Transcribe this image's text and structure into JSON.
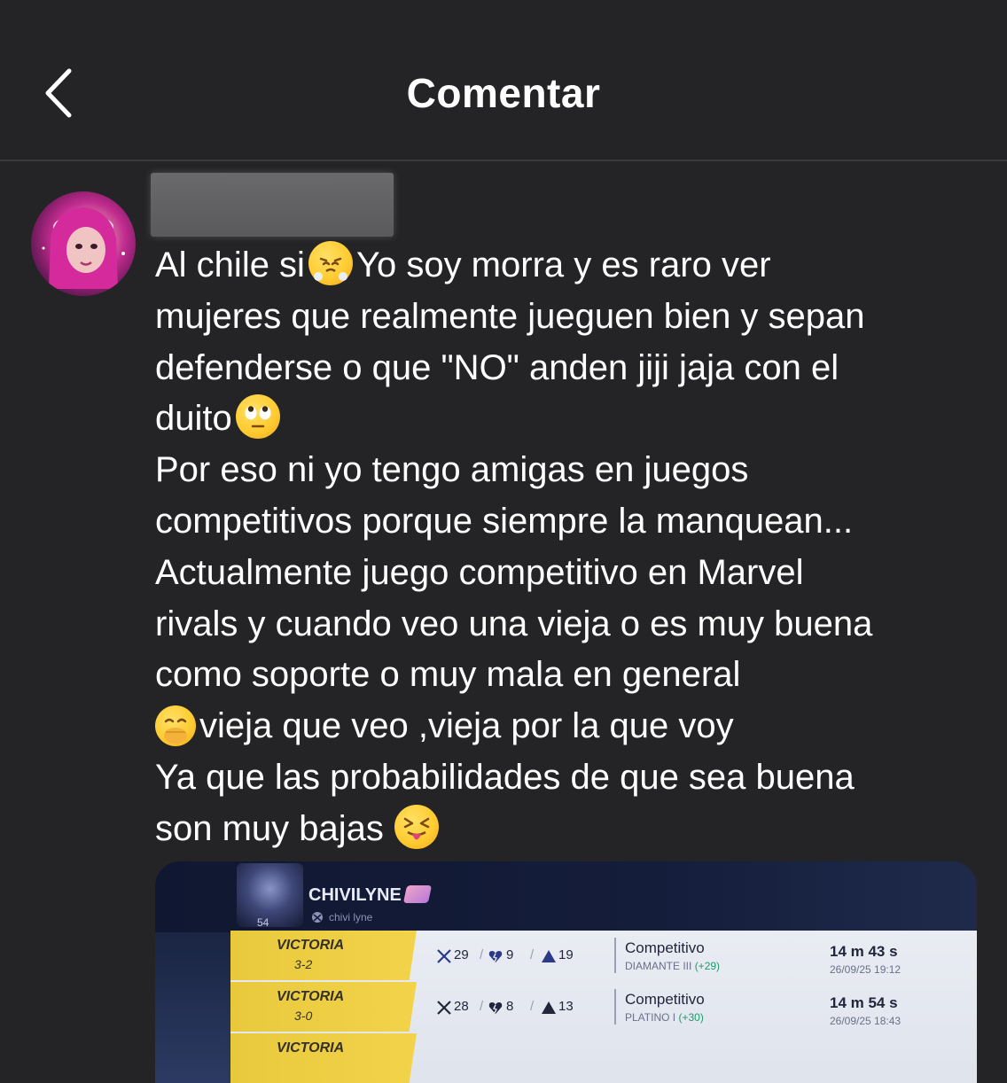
{
  "header": {
    "title": "Comentar"
  },
  "comment": {
    "lines": [
      "Al chile si",
      "Yo soy morra y es raro ver",
      "mujeres que realmente jueguen bien y sepan",
      "defenderse o que \"NO\" anden jiji jaja con el",
      "duito",
      "Por eso ni yo tengo amigas en juegos",
      "competitivos porque siempre la manquean...",
      "Actualmente juego competitivo en Marvel",
      "rivals y cuando veo una vieja o es muy buena",
      "como soporte o muy mala en general",
      "vieja que veo ,vieja por la que voy",
      "Ya que las probabilidades de que sea buena",
      "son muy bajas"
    ],
    "emojis": [
      "face-with-steam-emoji",
      "eye-roll-emoji",
      "hand-over-mouth-emoji",
      "squinting-tongue-emoji"
    ]
  },
  "attachment": {
    "player_name": "CHIVILYNE",
    "player_tag": "chivi lyne",
    "level": "54",
    "matches": [
      {
        "result": "VICTORIA",
        "score": "3-2",
        "kills": "29",
        "deaths": "9",
        "assists": "19",
        "mode": "Competitivo",
        "rank": "DIAMANTE III",
        "rank_gain": "(+29)",
        "duration": "14 m 43 s",
        "date": "26/09/25 19:12"
      },
      {
        "result": "VICTORIA",
        "score": "3-0",
        "kills": "28",
        "deaths": "8",
        "assists": "13",
        "mode": "Competitivo",
        "rank": "PLATINO I",
        "rank_gain": "(+30)",
        "duration": "14 m 54 s",
        "date": "26/09/25 18:43"
      },
      {
        "result": "VICTORIA"
      }
    ]
  },
  "colors": {
    "background": "#242426",
    "text": "#ffffff",
    "result_banner": "#f2d34a"
  }
}
